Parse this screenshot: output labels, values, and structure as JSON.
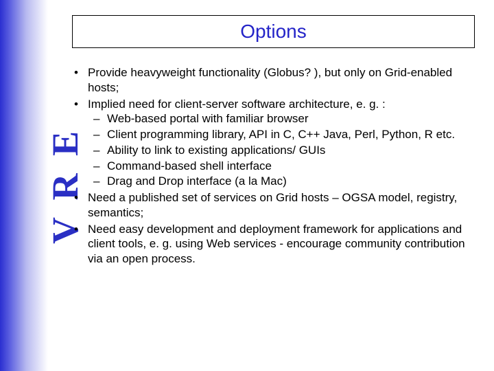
{
  "sidebar": {
    "logo_text": "V R E"
  },
  "title": "Options",
  "bullets": {
    "b1": "Provide heavyweight functionality (Globus? ), but only on Grid-enabled hosts;",
    "b2": "Implied need for client-server software architecture, e. g. :",
    "b2_sub": {
      "s1": "Web-based portal with familiar browser",
      "s2": "Client programming library, API in C, C++ Java, Perl, Python, R etc.",
      "s3": "Ability to link to existing applications/ GUIs",
      "s4": "Command-based shell interface",
      "s5": "Drag and Drop interface (a la Mac)"
    },
    "b3": "Need a published set of services on Grid hosts – OGSA model, registry, semantics;",
    "b4": "Need easy development and deployment framework for applications and client tools, e. g. using Web services - encourage community contribution via an open process."
  }
}
